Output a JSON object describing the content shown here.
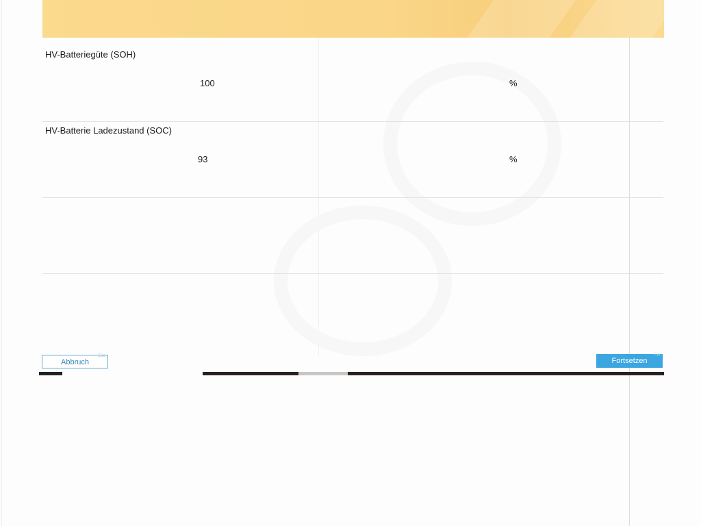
{
  "rows": [
    {
      "label": "HV-Batteriegüte (SOH)",
      "value": "100",
      "unit": "%"
    },
    {
      "label": "HV-Batterie Ladezustand (SOC)",
      "value": "93",
      "unit": "%"
    },
    {
      "label": "",
      "value": "",
      "unit": ""
    },
    {
      "label": "",
      "value": "",
      "unit": ""
    }
  ],
  "buttons": {
    "cancel_label": "Abbruch",
    "cancel_key": "Esc",
    "continue_label": "Fortsetzen",
    "continue_key": "F12"
  },
  "colors": {
    "header_band": "#fad688",
    "continue_button": "#3ba6e0",
    "cancel_border": "#6aa8cf"
  }
}
